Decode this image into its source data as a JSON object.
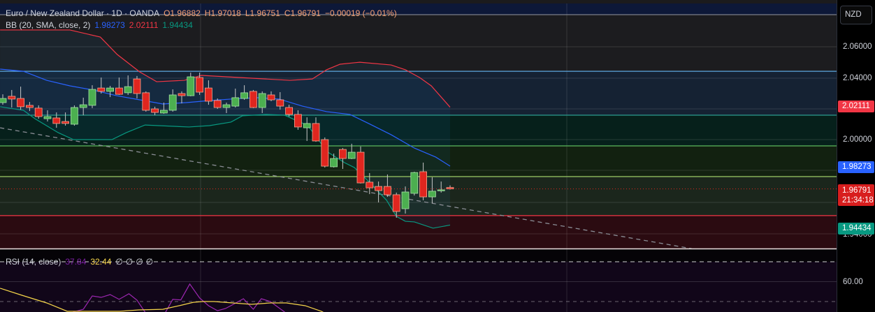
{
  "legend": {
    "symbol": "Euro / New Zealand Dollar · 1D · OANDA",
    "open": "O1.96882",
    "high": "H1.97018",
    "low": "L1.96751",
    "close": "C1.96791",
    "change": "−0.00019 (−0.01%)",
    "bb_label": "BB (20, SMA, close, 2)",
    "bb_basis": "1.98273",
    "bb_upper": "2.02111",
    "bb_lower": "1.94434",
    "rsi_label": "RSI (14, close)",
    "rsi_value": "37.84",
    "rsi_ma": "32.44",
    "rsi_extra": [
      "∅",
      "∅",
      "∅",
      "∅"
    ]
  },
  "axis": {
    "currency": "NZD",
    "ticks": [
      "2.06000",
      "2.04000",
      "2.00000",
      "1.94000"
    ],
    "rsi_ticks": [
      "60.00"
    ],
    "badges": {
      "upper": "2.02111",
      "basis": "1.98273",
      "last": "1.96791",
      "countdown": "21:34:18",
      "lower": "1.94434"
    }
  },
  "colors": {
    "up": "#4caf50",
    "down": "#e0261f",
    "bb_upper": "#f23645",
    "bb_basis": "#2962ff",
    "bb_lower": "#089981",
    "rsi": "#9c27b0",
    "rsi_ma": "#f5d54a",
    "legend_values": "#f7a172"
  },
  "chart_data": {
    "type": "candlestick",
    "title": "Euro / New Zealand Dollar · 1D · OANDA",
    "ylim": [
      1.92,
      2.09
    ],
    "yticks": [
      2.06,
      2.04,
      2.0,
      1.94
    ],
    "last_price": 1.96791,
    "candles": [
      [
        2.0241,
        2.0295,
        2.0227,
        2.0268
      ],
      [
        2.0282,
        2.0323,
        2.0209,
        2.0264
      ],
      [
        2.0268,
        2.0345,
        2.0195,
        2.0214
      ],
      [
        2.0223,
        2.0245,
        2.0186,
        2.0209
      ],
      [
        2.0205,
        2.0223,
        2.0136,
        2.015
      ],
      [
        2.0136,
        2.0191,
        2.0118,
        2.015
      ],
      [
        2.0141,
        2.0177,
        2.0077,
        2.0105
      ],
      [
        2.0118,
        2.0177,
        2.0091,
        2.0105
      ],
      [
        2.01,
        2.0223,
        2.0091,
        2.0209
      ],
      [
        2.0209,
        2.0273,
        2.0159,
        2.0227
      ],
      [
        2.0223,
        2.0354,
        2.0205,
        2.0327
      ],
      [
        2.0336,
        2.0404,
        2.03,
        2.0314
      ],
      [
        2.0314,
        2.035,
        2.0277,
        2.0336
      ],
      [
        2.0336,
        2.0404,
        2.0291,
        2.0295
      ],
      [
        2.0305,
        2.0418,
        2.0291,
        2.0345
      ],
      [
        2.0395,
        2.0414,
        2.0268,
        2.03
      ],
      [
        2.0305,
        2.0314,
        2.0182,
        2.0191
      ],
      [
        2.02,
        2.0214,
        2.0159,
        2.0177
      ],
      [
        2.0173,
        2.0241,
        2.0168,
        2.0191
      ],
      [
        2.0191,
        2.0327,
        2.0182,
        2.0291
      ],
      [
        2.03,
        2.0314,
        2.0236,
        2.0286
      ],
      [
        2.0286,
        2.0436,
        2.0282,
        2.0409
      ],
      [
        2.0404,
        2.0436,
        2.0291,
        2.0309
      ],
      [
        2.0336,
        2.0386,
        2.0227,
        2.025
      ],
      [
        2.0255,
        2.0268,
        2.02,
        2.0209
      ],
      [
        2.0209,
        2.0241,
        2.0173,
        2.0227
      ],
      [
        2.0218,
        2.0332,
        2.0209,
        2.0273
      ],
      [
        2.0268,
        2.0354,
        2.0259,
        2.0305
      ],
      [
        2.0314,
        2.0323,
        2.0205,
        2.0209
      ],
      [
        2.0209,
        2.0314,
        2.0173,
        2.03
      ],
      [
        2.0291,
        2.0314,
        2.025,
        2.0259
      ],
      [
        2.0259,
        2.0309,
        2.0195,
        2.0218
      ],
      [
        2.0209,
        2.0227,
        2.015,
        2.0164
      ],
      [
        2.0164,
        2.0191,
        2.0064,
        2.0082
      ],
      [
        2.0077,
        2.0145,
        1.9991,
        2.0105
      ],
      [
        2.0105,
        2.0145,
        1.9986,
        1.9991
      ],
      [
        2.0,
        2.0014,
        1.9818,
        1.9827
      ],
      [
        1.9823,
        1.9909,
        1.9818,
        1.9877
      ],
      [
        1.9936,
        1.9945,
        1.9809,
        1.9877
      ],
      [
        1.9877,
        1.9973,
        1.9873,
        1.9918
      ],
      [
        1.9918,
        1.9955,
        1.9714,
        1.9718
      ],
      [
        1.9723,
        1.9782,
        1.9645,
        1.9686
      ],
      [
        1.9695,
        1.9727,
        1.9591,
        1.9668
      ],
      [
        1.9695,
        1.9773,
        1.9627,
        1.9641
      ],
      [
        1.9641,
        1.9655,
        1.9491,
        1.9532
      ],
      [
        1.955,
        1.9695,
        1.9518,
        1.9659
      ],
      [
        1.965,
        1.9791,
        1.9636,
        1.9786
      ],
      [
        1.9791,
        1.985,
        1.9605,
        1.9627
      ],
      [
        1.9627,
        1.9755,
        1.9586,
        1.9664
      ],
      [
        1.9668,
        1.9727,
        1.9655,
        1.9673
      ],
      [
        1.96882,
        1.97018,
        1.96751,
        1.96791
      ]
    ],
    "bollinger": {
      "upper": [
        [
          -0.3,
          2.0714
        ],
        [
          7.5,
          2.0714
        ],
        [
          10.9,
          2.0668
        ],
        [
          12.8,
          2.0554
        ],
        [
          15.3,
          2.0441
        ],
        [
          17.2,
          2.0377
        ],
        [
          20.3,
          2.0386
        ],
        [
          22.2,
          2.0418
        ],
        [
          27.8,
          2.04
        ],
        [
          32.1,
          2.0386
        ],
        [
          34.6,
          2.0395
        ],
        [
          36.2,
          2.0455
        ],
        [
          37.7,
          2.0491
        ],
        [
          39.9,
          2.0504
        ],
        [
          43.4,
          2.0486
        ],
        [
          45,
          2.0455
        ],
        [
          46.6,
          2.0404
        ],
        [
          47.9,
          2.035
        ],
        [
          50,
          2.02111
        ]
      ],
      "basis": [
        [
          -0.3,
          2.0459
        ],
        [
          2.3,
          2.0445
        ],
        [
          4.9,
          2.0386
        ],
        [
          7.5,
          2.035
        ],
        [
          10.1,
          2.0323
        ],
        [
          12.7,
          2.0286
        ],
        [
          15.3,
          2.0259
        ],
        [
          17.9,
          2.0232
        ],
        [
          20.5,
          2.0241
        ],
        [
          23.1,
          2.0254
        ],
        [
          25.5,
          2.0264
        ],
        [
          28.4,
          2.0273
        ],
        [
          30.9,
          2.0264
        ],
        [
          33.5,
          2.0218
        ],
        [
          36.2,
          2.0182
        ],
        [
          38.8,
          2.0164
        ],
        [
          40.9,
          2.0105
        ],
        [
          43.4,
          2.0032
        ],
        [
          46,
          1.9945
        ],
        [
          48.4,
          1.9886
        ],
        [
          50,
          1.98273
        ]
      ],
      "lower": [
        [
          -0.3,
          2.0214
        ],
        [
          2.3,
          2.0191
        ],
        [
          3.6,
          2.0136
        ],
        [
          6.2,
          2.0045
        ],
        [
          7.9,
          2.0
        ],
        [
          12.2,
          2.0
        ],
        [
          13.8,
          2.0045
        ],
        [
          15.9,
          2.0095
        ],
        [
          20.8,
          2.0082
        ],
        [
          23.1,
          2.0091
        ],
        [
          25.5,
          2.0114
        ],
        [
          26.8,
          2.0155
        ],
        [
          29.4,
          2.0164
        ],
        [
          31.5,
          2.0159
        ],
        [
          34.1,
          2.0091
        ],
        [
          35.1,
          2.0014
        ],
        [
          36.2,
          1.9923
        ],
        [
          38.2,
          1.985
        ],
        [
          39.3,
          1.9818
        ],
        [
          40.9,
          1.9727
        ],
        [
          42.9,
          1.9605
        ],
        [
          44,
          1.95
        ],
        [
          45,
          1.9468
        ],
        [
          46,
          1.9464
        ],
        [
          48.1,
          1.9423
        ],
        [
          50,
          1.94434
        ]
      ]
    },
    "levels": [
      {
        "price": 2.0445,
        "color": "#5ca8e0",
        "zone_below": "#152233"
      },
      {
        "price": 2.0159,
        "color": "#2a9d8f",
        "zone_below": "#06201b"
      },
      {
        "price": 1.9959,
        "color": "#5cb85c",
        "zone_below": "#122110"
      },
      {
        "price": 1.9759,
        "color": "#9ccc65",
        "zone_below": "#1b261c"
      },
      {
        "price": 1.9505,
        "color": "#f23645",
        "zone_below": "#2b0b11"
      }
    ],
    "trendline": {
      "start": [
        -0.3,
        2.0077
      ],
      "end": [
        77,
        1.929
      ]
    },
    "rsi": {
      "ylim": [
        40,
        78
      ],
      "levels": [
        70,
        60,
        50
      ],
      "values": [
        [
          7.0,
          43
        ],
        [
          7.9,
          44.7
        ],
        [
          9,
          46.1
        ],
        [
          10,
          52.8
        ],
        [
          11,
          52.1
        ],
        [
          12,
          53.5
        ],
        [
          13,
          51.1
        ],
        [
          14.1,
          53.9
        ],
        [
          15,
          50.7
        ],
        [
          15.9,
          44.7
        ],
        [
          16.5,
          42
        ],
        [
          17.6,
          42
        ],
        [
          18.2,
          44.7
        ],
        [
          19,
          51.1
        ],
        [
          19.9,
          50.8
        ],
        [
          20.9,
          58.8
        ],
        [
          22,
          51.8
        ],
        [
          23,
          47.9
        ],
        [
          24,
          45.4
        ],
        [
          24.9,
          46.5
        ],
        [
          25.9,
          48.9
        ],
        [
          26.9,
          51.4
        ],
        [
          28,
          46.1
        ],
        [
          28.9,
          51.4
        ],
        [
          29.9,
          50
        ],
        [
          31.4,
          45.1
        ],
        [
          32,
          43
        ]
      ],
      "ma": [
        [
          -0.3,
          56.7
        ],
        [
          2.1,
          53.2
        ],
        [
          4.9,
          49.3
        ],
        [
          7.2,
          45.1
        ],
        [
          13.1,
          45.1
        ],
        [
          15.2,
          45.8
        ],
        [
          17.9,
          46.1
        ],
        [
          20,
          48.2
        ],
        [
          21.3,
          49.6
        ],
        [
          22.4,
          50
        ],
        [
          23.6,
          50
        ],
        [
          25.7,
          49.3
        ],
        [
          27.8,
          48.6
        ],
        [
          29.9,
          49.3
        ],
        [
          31.7,
          49.3
        ],
        [
          33.8,
          47.9
        ],
        [
          35.6,
          45.1
        ],
        [
          37,
          42
        ]
      ]
    }
  }
}
